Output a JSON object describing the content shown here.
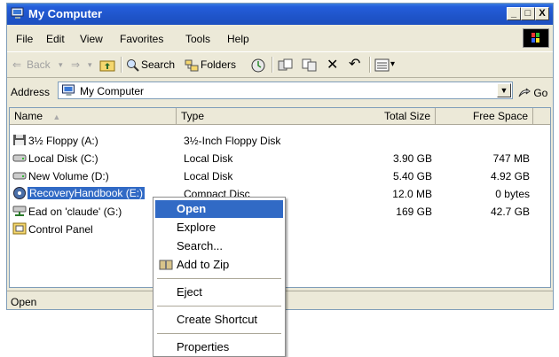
{
  "window": {
    "title": "My Computer",
    "controls": {
      "minimize": "_",
      "maximize": "□",
      "close": "X"
    }
  },
  "menu": [
    "File",
    "Edit",
    "View",
    "Favorites",
    "Tools",
    "Help"
  ],
  "toolbar": {
    "back": "Back",
    "search": "Search",
    "folders": "Folders",
    "view_menu_arrow": "▾"
  },
  "address": {
    "label": "Address",
    "value": "My Computer",
    "go": "Go"
  },
  "columns": [
    "Name",
    "Type",
    "Total Size",
    "Free Space"
  ],
  "items": [
    {
      "name": "3½ Floppy (A:)",
      "type": "3½-Inch Floppy Disk",
      "total": "",
      "free": "",
      "icon": "floppy-icon"
    },
    {
      "name": "Local Disk (C:)",
      "type": "Local Disk",
      "total": "3.90 GB",
      "free": "747 MB",
      "icon": "hard-disk-icon"
    },
    {
      "name": "New Volume (D:)",
      "type": "Local Disk",
      "total": "5.40 GB",
      "free": "4.92 GB",
      "icon": "hard-disk-icon"
    },
    {
      "name": "RecoveryHandbook (E:)",
      "type": "Compact Disc",
      "total": "12.0 MB",
      "free": "0 bytes",
      "icon": "cd-icon"
    },
    {
      "name": "Ead on 'claude' (G:)",
      "type": "",
      "total": "169 GB",
      "free": "42.7 GB",
      "icon": "network-drive-icon"
    },
    {
      "name": "Control Panel",
      "type": "",
      "total": "",
      "free": "",
      "icon": "control-panel-icon"
    }
  ],
  "status": {
    "text": "Open"
  },
  "context_menu": {
    "open": "Open",
    "explore": "Explore",
    "search": "Search...",
    "add_to_zip": "Add to Zip",
    "eject": "Eject",
    "create_shortcut": "Create Shortcut",
    "properties": "Properties"
  },
  "colors": {
    "title_bar": "#245edb",
    "selection": "#316ac5",
    "chrome": "#ece9d8"
  }
}
